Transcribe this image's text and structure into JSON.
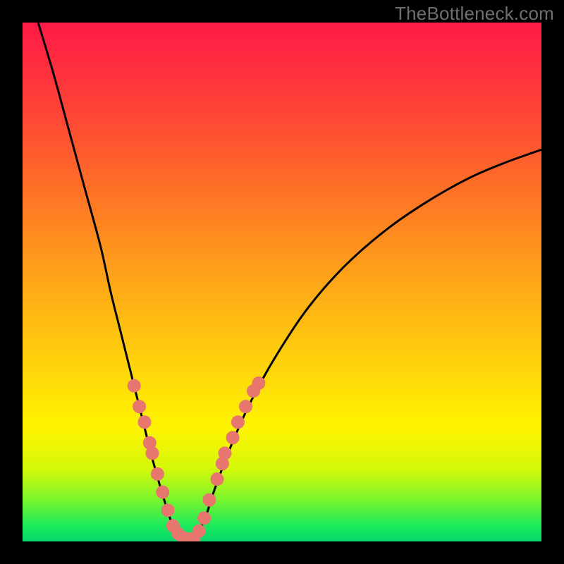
{
  "watermark": "TheBottleneck.com",
  "chart_data": {
    "type": "line",
    "title": "",
    "xlabel": "",
    "ylabel": "",
    "xlim": [
      0,
      100
    ],
    "ylim": [
      0,
      100
    ],
    "grid": false,
    "annotations": [],
    "curve_left": [
      {
        "x": 3.0,
        "y": 100.0
      },
      {
        "x": 6.0,
        "y": 90.0
      },
      {
        "x": 9.0,
        "y": 79.0
      },
      {
        "x": 12.0,
        "y": 68.0
      },
      {
        "x": 15.0,
        "y": 57.0
      },
      {
        "x": 17.0,
        "y": 48.0
      },
      {
        "x": 19.0,
        "y": 40.0
      },
      {
        "x": 21.0,
        "y": 32.0
      },
      {
        "x": 23.0,
        "y": 24.0
      },
      {
        "x": 25.0,
        "y": 16.0
      },
      {
        "x": 27.0,
        "y": 9.0
      },
      {
        "x": 29.0,
        "y": 3.0
      },
      {
        "x": 31.0,
        "y": 0.5
      }
    ],
    "curve_right": [
      {
        "x": 33.0,
        "y": 0.5
      },
      {
        "x": 35.0,
        "y": 4.0
      },
      {
        "x": 37.0,
        "y": 10.0
      },
      {
        "x": 40.0,
        "y": 18.0
      },
      {
        "x": 44.0,
        "y": 27.0
      },
      {
        "x": 49.0,
        "y": 36.0
      },
      {
        "x": 55.0,
        "y": 45.0
      },
      {
        "x": 62.0,
        "y": 53.0
      },
      {
        "x": 70.0,
        "y": 60.0
      },
      {
        "x": 78.0,
        "y": 65.5
      },
      {
        "x": 86.0,
        "y": 70.0
      },
      {
        "x": 93.0,
        "y": 73.0
      },
      {
        "x": 100.0,
        "y": 75.5
      }
    ],
    "markers_left": [
      {
        "x": 21.5,
        "y": 30.0
      },
      {
        "x": 22.5,
        "y": 26.0
      },
      {
        "x": 23.5,
        "y": 23.0
      },
      {
        "x": 24.5,
        "y": 19.0
      },
      {
        "x": 25.0,
        "y": 17.0
      },
      {
        "x": 26.0,
        "y": 13.0
      },
      {
        "x": 27.0,
        "y": 9.5
      },
      {
        "x": 28.0,
        "y": 6.0
      },
      {
        "x": 29.0,
        "y": 3.0
      },
      {
        "x": 30.0,
        "y": 1.5
      },
      {
        "x": 31.0,
        "y": 0.7
      },
      {
        "x": 32.0,
        "y": 0.5
      }
    ],
    "markers_right": [
      {
        "x": 33.0,
        "y": 0.5
      },
      {
        "x": 34.0,
        "y": 2.0
      },
      {
        "x": 35.0,
        "y": 4.5
      },
      {
        "x": 36.0,
        "y": 8.0
      },
      {
        "x": 37.5,
        "y": 12.0
      },
      {
        "x": 38.5,
        "y": 15.0
      },
      {
        "x": 39.0,
        "y": 17.0
      },
      {
        "x": 40.5,
        "y": 20.0
      },
      {
        "x": 41.5,
        "y": 23.0
      },
      {
        "x": 43.0,
        "y": 26.0
      },
      {
        "x": 44.5,
        "y": 29.0
      },
      {
        "x": 45.5,
        "y": 30.5
      }
    ],
    "colors": {
      "curve": "#000000",
      "marker_fill": "#e7766f",
      "marker_stroke": "#e7766f"
    },
    "marker_radius": 9
  }
}
